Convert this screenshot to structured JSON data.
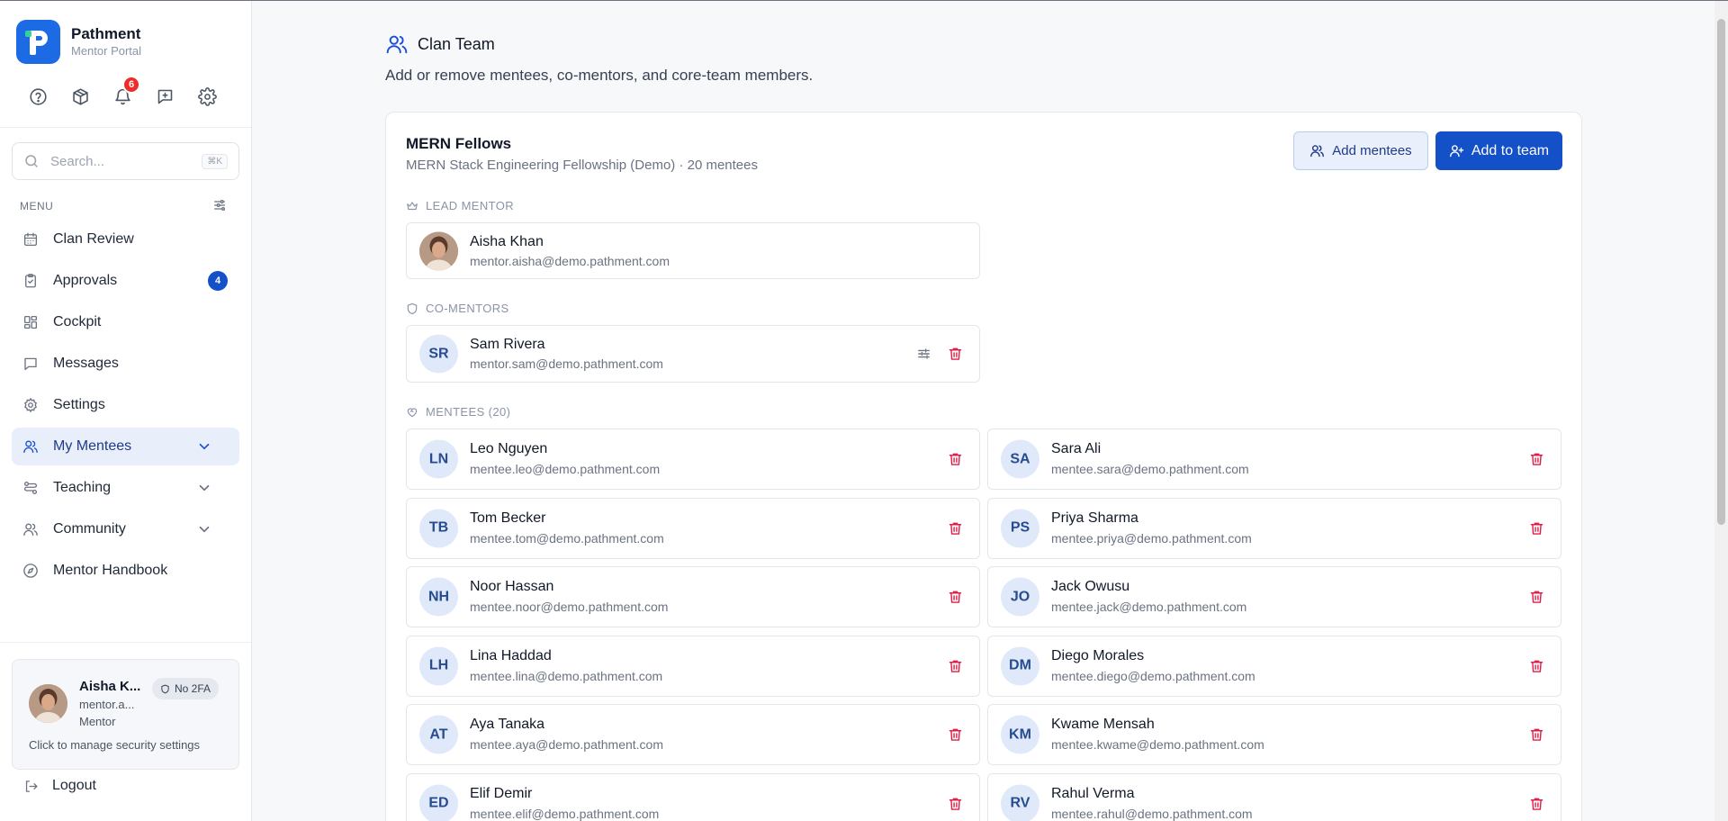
{
  "brand": {
    "name": "Pathment",
    "sub": "Mentor Portal"
  },
  "top_icons": [
    {
      "name": "help-icon"
    },
    {
      "name": "package-icon"
    },
    {
      "name": "bell-icon",
      "badge": "6"
    },
    {
      "name": "feedback-icon"
    },
    {
      "name": "gear-icon"
    }
  ],
  "search": {
    "placeholder": "Search...",
    "shortcut": "⌘K"
  },
  "menu": {
    "label": "MENU",
    "items": [
      {
        "label": "Clan Review",
        "icon": "calendar-icon"
      },
      {
        "label": "Approvals",
        "icon": "clipboard-check-icon",
        "badge": "4"
      },
      {
        "label": "Cockpit",
        "icon": "dashboard-icon"
      },
      {
        "label": "Messages",
        "icon": "message-icon"
      },
      {
        "label": "Settings",
        "icon": "gear-icon"
      },
      {
        "label": "My Mentees",
        "icon": "users-icon",
        "active": true,
        "expandable": true
      },
      {
        "label": "Teaching",
        "icon": "teaching-icon",
        "expandable": true
      },
      {
        "label": "Community",
        "icon": "community-icon",
        "expandable": true
      },
      {
        "label": "Mentor Handbook",
        "icon": "compass-icon"
      }
    ]
  },
  "user": {
    "name": "Aisha K...",
    "email": "mentor.a...",
    "role": "Mentor",
    "twofa": "No 2FA",
    "hint": "Click to manage security settings"
  },
  "logout": "Logout",
  "page": {
    "title": "Clan Team",
    "description": "Add or remove mentees, co-mentors, and core-team members."
  },
  "team": {
    "name": "MERN Fellows",
    "subtitle": "MERN Stack Engineering Fellowship (Demo) · 20 mentees",
    "add_mentees": "Add mentees",
    "add_to_team": "Add to team"
  },
  "lead": {
    "label": "LEAD MENTOR",
    "name": "Aisha Khan",
    "email": "mentor.aisha@demo.pathment.com"
  },
  "comentors": {
    "label": "CO-MENTORS",
    "items": [
      {
        "initials": "SR",
        "name": "Sam Rivera",
        "email": "mentor.sam@demo.pathment.com"
      }
    ]
  },
  "mentees": {
    "label": "MENTEES (20)",
    "items": [
      {
        "initials": "LN",
        "name": "Leo Nguyen",
        "email": "mentee.leo@demo.pathment.com"
      },
      {
        "initials": "SA",
        "name": "Sara Ali",
        "email": "mentee.sara@demo.pathment.com"
      },
      {
        "initials": "TB",
        "name": "Tom Becker",
        "email": "mentee.tom@demo.pathment.com"
      },
      {
        "initials": "PS",
        "name": "Priya Sharma",
        "email": "mentee.priya@demo.pathment.com"
      },
      {
        "initials": "NH",
        "name": "Noor Hassan",
        "email": "mentee.noor@demo.pathment.com"
      },
      {
        "initials": "JO",
        "name": "Jack Owusu",
        "email": "mentee.jack@demo.pathment.com"
      },
      {
        "initials": "LH",
        "name": "Lina Haddad",
        "email": "mentee.lina@demo.pathment.com"
      },
      {
        "initials": "DM",
        "name": "Diego Morales",
        "email": "mentee.diego@demo.pathment.com"
      },
      {
        "initials": "AT",
        "name": "Aya Tanaka",
        "email": "mentee.aya@demo.pathment.com"
      },
      {
        "initials": "KM",
        "name": "Kwame Mensah",
        "email": "mentee.kwame@demo.pathment.com"
      },
      {
        "initials": "ED",
        "name": "Elif Demir",
        "email": "mentee.elif@demo.pathment.com"
      },
      {
        "initials": "RV",
        "name": "Rahul Verma",
        "email": "mentee.rahul@demo.pathment.com"
      }
    ]
  },
  "colors": {
    "primary": "#1450c8",
    "danger": "#e11d48",
    "notif": "#ef2b2b",
    "accent_green": "#34d399"
  }
}
